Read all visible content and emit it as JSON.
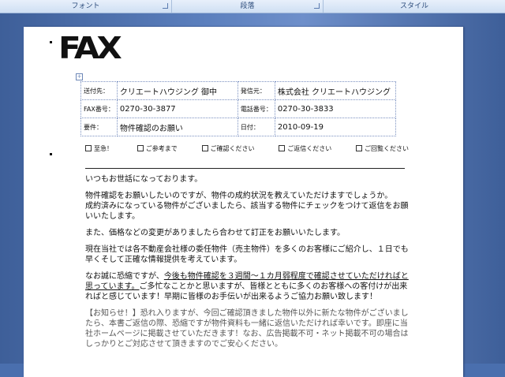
{
  "ribbon": {
    "groups": [
      {
        "label": "フォント"
      },
      {
        "label": "段落"
      },
      {
        "label": "スタイル"
      }
    ]
  },
  "fax_logo": "FAX",
  "header": {
    "rows": [
      {
        "l1": "送付先：",
        "v1": "クリエートハウジング 御中",
        "l2": "発信元：",
        "v2": "株式会社 クリエートハウジング"
      },
      {
        "l1": "FAX番号：",
        "v1": "0270-30-3877",
        "l2": "電話番号：",
        "v2": "0270-30-3833"
      },
      {
        "l1": "要件：",
        "v1": "物件確認のお願い",
        "l2": "日付：",
        "v2": "2010-09-19"
      }
    ]
  },
  "checkboxes": [
    {
      "label": "至急！"
    },
    {
      "label": "ご参考まで"
    },
    {
      "label": "ご確認ください"
    },
    {
      "label": "ご返信ください"
    },
    {
      "label": "ご回覧ください"
    }
  ],
  "body": {
    "p1": "いつもお世話になっております。",
    "p2a": "物件確認をお願いしたいのですが、物件の成約状況を教えていただけますでしょうか。",
    "p2b": "成約済みになっている物件がございましたら、該当する物件にチェックをつけて返信をお願いいたします。",
    "p3": "また、価格などの変更がありましたら合わせて訂正をお願いいたします。",
    "p4": "現在当社では各不動産会社様の委任物件（売主物件）を多くのお客様にご紹介し、１日でも早くそして正確な情報提供を考えています。",
    "p5a": "なお誠に恐縮ですが、",
    "p5u": "今後も物件確認を３週間～１カ月弱程度で確認させていただければと思っています。",
    "p5b": "ご多忙なことかと思いますが、皆様とともに多くのお客様への客付けが出来ればと感じています！早期に皆様のお手伝いが出来るようご協力お願い致します！",
    "p6": "【お知らせ！】恐れ入りますが、今回ご確認頂きました物件以外に新たな物件がございましたら、本書ご返信の際、恐縮ですが物件資料も一緒に返信いただければ幸いです。即座に当社ホームページに掲載させていただきます！なお、広告掲載不可・ネット掲載不可の場合はしっかりとご対応させて頂きますのでご安心ください。"
  }
}
